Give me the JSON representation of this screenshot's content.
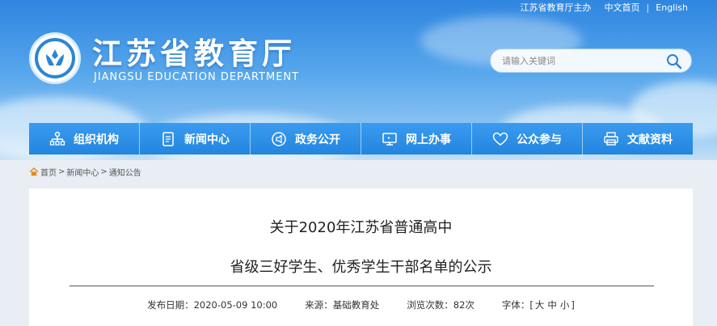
{
  "topbar": {
    "sponsor": "江苏省教育厅主办",
    "chinese_home": "中文首页",
    "separator": "|",
    "english": "English"
  },
  "header": {
    "title": "江苏省教育厅",
    "subtitle": "JIANGSU EDUCATION DEPARTMENT"
  },
  "search": {
    "placeholder": "请输入关键词"
  },
  "nav": {
    "items": [
      {
        "label": "组织机构",
        "icon": "org-chart-icon"
      },
      {
        "label": "新闻中心",
        "icon": "document-icon"
      },
      {
        "label": "政务公开",
        "icon": "megaphone-icon"
      },
      {
        "label": "网上办事",
        "icon": "monitor-icon"
      },
      {
        "label": "公众参与",
        "icon": "heart-icon"
      },
      {
        "label": "文献资料",
        "icon": "printer-icon"
      }
    ]
  },
  "breadcrumb": {
    "home": "首页",
    "news": "新闻中心",
    "notice": "通知公告",
    "sep": ">"
  },
  "article": {
    "title_line1": "关于2020年江苏省普通高中",
    "title_line2": "省级三好学生、优秀学生干部名单的公示",
    "publish_label": "发布日期：",
    "publish_date": "2020-05-09 10:00",
    "source_label": "来源：",
    "source": "基础教育处",
    "views_label": "浏览次数：",
    "views": "82次",
    "font_label": "字体：",
    "font_open": "[",
    "font_large": "大",
    "font_medium": "中",
    "font_small": "小",
    "font_close": "]"
  },
  "colors": {
    "accent": "#2f8ee3",
    "banner_top": "#2f86e0",
    "content_bg": "#ffffff"
  }
}
